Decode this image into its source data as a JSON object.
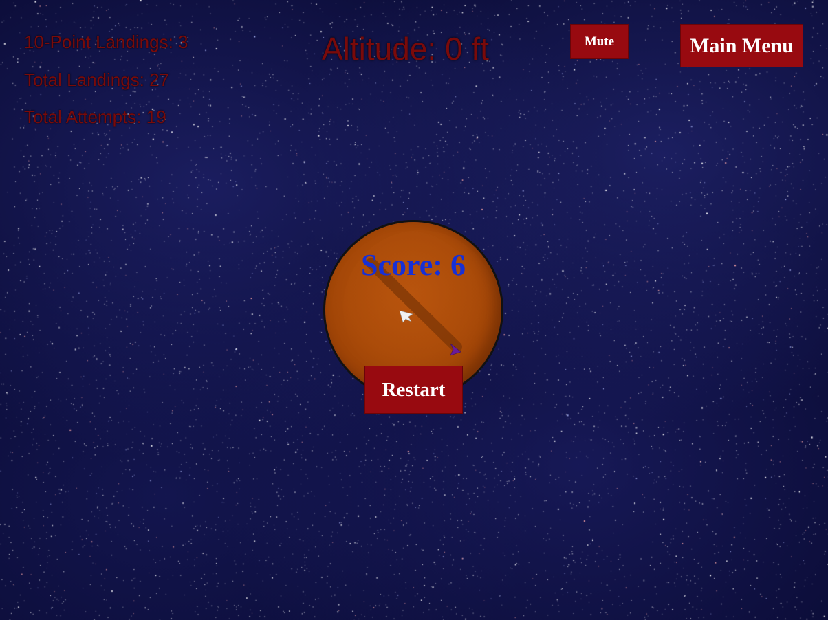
{
  "stats": {
    "ten_point_landings": "10-Point Landings: 3",
    "total_landings": "Total Landings: 27",
    "total_attempts": "Total Attempts: 19"
  },
  "altitude": "Altitude: 0 ft",
  "buttons": {
    "mute": "Mute",
    "main_menu": "Main Menu",
    "restart": "Restart"
  },
  "score": "Score: 6",
  "colors": {
    "stat_text": "#7a0a0a",
    "button_bg": "#980a10",
    "score_text": "#1730d6",
    "planet": "#a94a08"
  },
  "icons": {
    "lander": "lander-ship-icon",
    "target": "purple-arrow-icon"
  }
}
